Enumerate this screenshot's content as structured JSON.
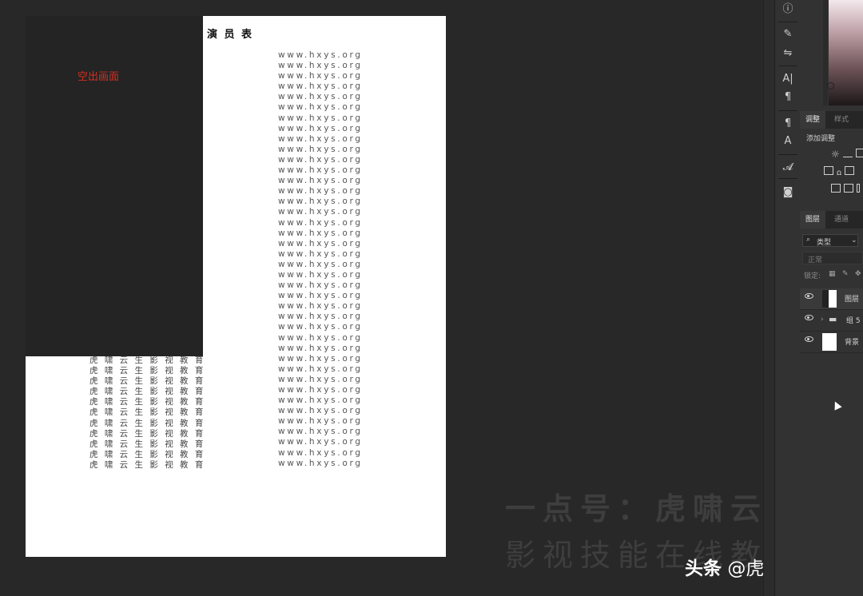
{
  "document": {
    "title": "演 员 表",
    "url_lines": [
      "www.hxys.org",
      "www.hxys.org",
      "www.hxys.org",
      "www.hxys.org",
      "www.hxys.org",
      "www.hxys.org",
      "www.hxys.org",
      "www.hxys.org",
      "www.hxys.org",
      "www.hxys.org",
      "www.hxys.org",
      "www.hxys.org",
      "www.hxys.org",
      "www.hxys.org",
      "www.hxys.org",
      "www.hxys.org",
      "www.hxys.org",
      "www.hxys.org",
      "www.hxys.org",
      "www.hxys.org",
      "www.hxys.org",
      "www.hxys.org",
      "www.hxys.org",
      "www.hxys.org",
      "www.hxys.org",
      "www.hxys.org",
      "www.hxys.org",
      "www.hxys.org",
      "www.hxys.org",
      "www.hxys.org",
      "www.hxys.org",
      "www.hxys.org",
      "www.hxys.org",
      "www.hxys.org",
      "www.hxys.org",
      "www.hxys.org",
      "www.hxys.org",
      "www.hxys.org",
      "www.hxys.org",
      "www.hxys.org"
    ],
    "name_lines": [
      "虎 啸 云 生 影 视 教 育",
      "虎 啸 云 生 影 视 教 育",
      "虎 啸 云 生 影 视 教 育",
      "虎 啸 云 生 影 视 教 育",
      "虎 啸 云 生 影 视 教 育",
      "虎 啸 云 生 影 视 教 育",
      "虎 啸 云 生 影 视 教 育",
      "虎 啸 云 生 影 视 教 育",
      "虎 啸 云 生 影 视 教 育",
      "虎 啸 云 生 影 视 教 育",
      "虎 啸 云 生 影 视 教 育"
    ],
    "blank_label": "空出画面",
    "label_color": "#d03020"
  },
  "watermark": {
    "line1": "一点号：虎啸云生",
    "line2": "影视技能在线教育",
    "credit_prefix": "头条",
    "credit_handle": "@虎啸云生"
  },
  "toolbar": {
    "icons": [
      "info-icon",
      "brush-settings-icon",
      "tool-presets-icon",
      "character-icon",
      "paragraph-icon",
      "paragraph-styles-icon",
      "character-styles-icon",
      "glyphs-icon",
      "layer-comps-icon"
    ],
    "glyphs": [
      "ⓘ",
      "✎",
      "⇋",
      "A|",
      "¶",
      "¶",
      "A",
      "𝓐",
      "◙"
    ]
  },
  "adjustments_panel": {
    "tabs": [
      "调整",
      "样式"
    ],
    "add_label": "添加调整"
  },
  "layers_panel": {
    "tabs": [
      "图层",
      "通道"
    ],
    "filter_kind": "类型",
    "blend_mode": "正常",
    "lock_label": "锁定:",
    "layers": [
      {
        "name": "图层",
        "type": "layer"
      },
      {
        "name": "组 5",
        "type": "group"
      },
      {
        "name": "背景",
        "type": "background"
      }
    ]
  }
}
